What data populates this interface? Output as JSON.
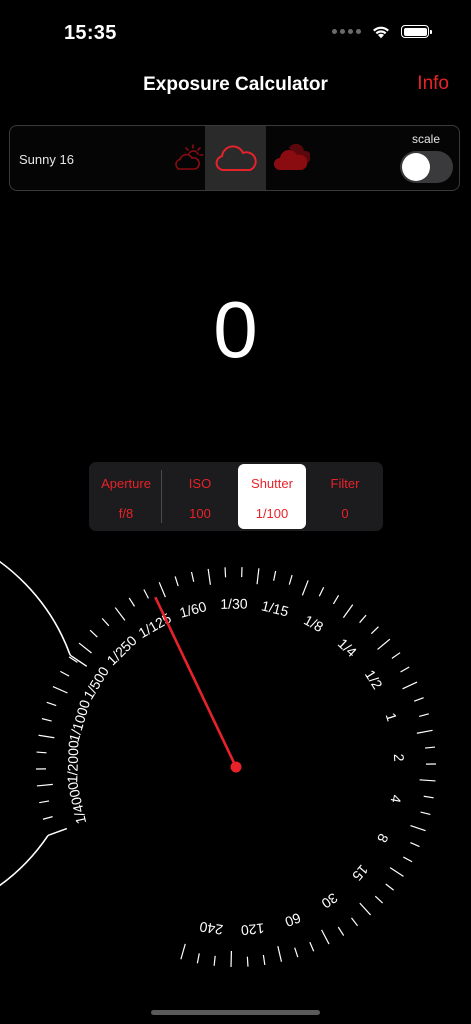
{
  "status_bar": {
    "time": "15:35",
    "icons": [
      "signal-dots-icon",
      "wifi-icon",
      "battery-icon"
    ]
  },
  "nav": {
    "title": "Exposure Calculator",
    "info_label": "Info"
  },
  "mode": {
    "label": "Sunny 16",
    "weather_options": [
      "sun-cloud-icon",
      "cloud-outline-icon",
      "heavy-cloud-icon"
    ],
    "selected_weather": "cloud-outline-icon",
    "scale_label": "scale",
    "scale_on": false
  },
  "ev_value": "0",
  "segments": [
    {
      "title": "Aperture",
      "value": "f/8"
    },
    {
      "title": "ISO",
      "value": "100"
    },
    {
      "title": "Shutter",
      "value": "1/100"
    },
    {
      "title": "Filter",
      "value": "0"
    }
  ],
  "selected_segment": "Shutter",
  "dial": {
    "labels": [
      "1/4000",
      "1/2000",
      "1/1000",
      "1/500",
      "1/250",
      "1/125",
      "1/60",
      "1/30",
      "1/15",
      "1/8",
      "1/4",
      "1/2",
      "1",
      "2",
      "4",
      "8",
      "15",
      "30",
      "60",
      "120",
      "240"
    ],
    "selected_value": "1/100"
  },
  "colors": {
    "accent": "#e8222a",
    "background": "#000000",
    "control_bg": "#1c1c1e",
    "cloud_dark": "#8a0c10"
  }
}
